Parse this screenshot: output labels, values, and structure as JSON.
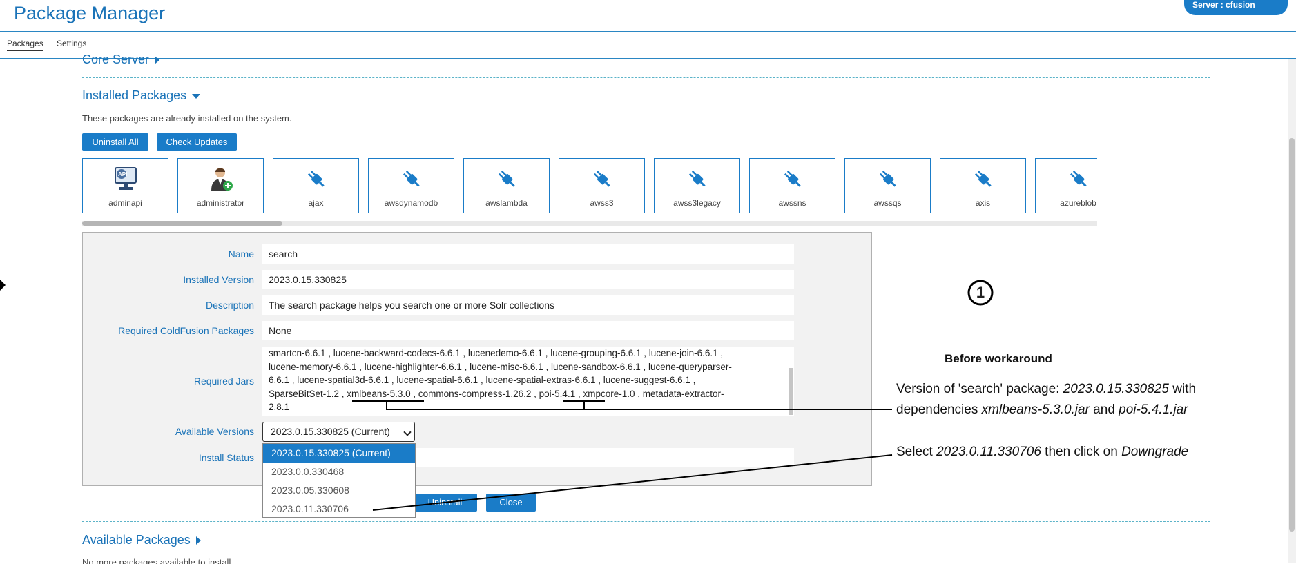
{
  "app": {
    "title": "Package Manager",
    "server": "Server : cfusion"
  },
  "tabs": [
    {
      "label": "Packages",
      "active": true
    },
    {
      "label": "Settings",
      "active": false
    }
  ],
  "core_server": {
    "label": "Core Server"
  },
  "installed": {
    "title": "Installed Packages",
    "description": "These packages are already installed on the system.",
    "uninstall_all": "Uninstall All",
    "check_updates": "Check Updates",
    "packages": [
      {
        "name": "adminapi",
        "icon": "api-monitor-icon"
      },
      {
        "name": "administrator",
        "icon": "admin-user-icon"
      },
      {
        "name": "ajax",
        "icon": "plug-icon"
      },
      {
        "name": "awsdynamodb",
        "icon": "plug-icon"
      },
      {
        "name": "awslambda",
        "icon": "plug-icon"
      },
      {
        "name": "awss3",
        "icon": "plug-icon"
      },
      {
        "name": "awss3legacy",
        "icon": "plug-icon"
      },
      {
        "name": "awssns",
        "icon": "plug-icon"
      },
      {
        "name": "awssqs",
        "icon": "plug-icon"
      },
      {
        "name": "axis",
        "icon": "plug-icon"
      },
      {
        "name": "azureblob",
        "icon": "plug-icon"
      }
    ]
  },
  "detail": {
    "name_label": "Name",
    "name_value": "search",
    "installed_label": "Installed Version",
    "installed_value": "2023.0.15.330825",
    "description_label": "Description",
    "description_value": "The search package helps you search one or more Solr collections",
    "required_cf_label": "Required ColdFusion Packages",
    "required_cf_value": "None",
    "jars_label": "Required Jars",
    "jars_lines": [
      "smartcn-6.6.1 , lucene-backward-codecs-6.6.1 , lucenedemo-6.6.1 , lucene-grouping-6.6.1 , lucene-join-6.6.1 ,",
      "lucene-memory-6.6.1 , lucene-highlighter-6.6.1 , lucene-misc-6.6.1 , lucene-sandbox-6.6.1 , lucene-queryparser-",
      "6.6.1 , lucene-spatial3d-6.6.1 , lucene-spatial-6.6.1 , lucene-spatial-extras-6.6.1 , lucene-suggest-6.6.1 ,",
      "SparseBitSet-1.2 , xmlbeans-5.3.0 , commons-compress-1.26.2 , poi-5.4.1 , xmpcore-1.0 , metadata-extractor-",
      "2.8.1"
    ],
    "available_label": "Available Versions",
    "available_selected": "2023.0.15.330825 (Current)",
    "versions": [
      "2023.0.15.330825 (Current)",
      "2023.0.0.330468",
      "2023.0.05.330608",
      "2023.0.11.330706"
    ],
    "status_label": "Install Status",
    "uninstall_button": "Uninstall",
    "close_button": "Close"
  },
  "available": {
    "title": "Available Packages",
    "note": "No more packages available to install"
  },
  "annotation": {
    "step": "1",
    "heading": "Before workaround",
    "line1_a": "Version of 'search' package: ",
    "line1_b": "2023.0.15.330825",
    "line1_c": " with",
    "line2_a": "dependencies ",
    "line2_b": "xmlbeans-5.3.0.jar",
    "line2_c": " and ",
    "line2_d": "poi-5.4.1.jar",
    "line3_a": "Select  ",
    "line3_b": "2023.0.11.330706",
    "line3_c": " then click on ",
    "line3_d": "Downgrade"
  }
}
